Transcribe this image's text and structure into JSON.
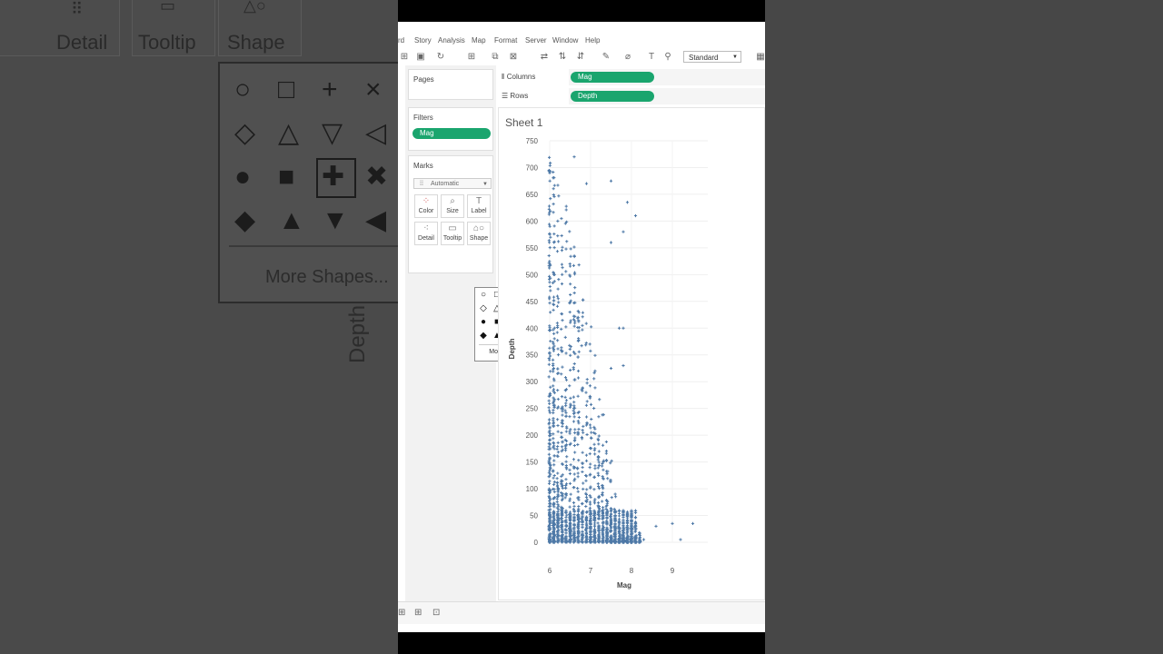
{
  "background": {
    "labels": {
      "detail": "Detail",
      "tooltip": "Tooltip",
      "shape": "Shape"
    },
    "more_shapes": "More Shapes...",
    "depth": "Depth"
  },
  "menu": [
    "rd",
    "Story",
    "Analysis",
    "Map",
    "Format",
    "Server",
    "Window",
    "Help"
  ],
  "toolbar": {
    "fit_select": "Standard"
  },
  "shelves": {
    "pages": "Pages",
    "filters": "Filters",
    "filter_pill": "Mag",
    "marks": "Marks",
    "mark_type": "Automatic",
    "columns_label": "Columns",
    "columns_pill": "Mag",
    "rows_label": "Rows",
    "rows_pill": "Depth"
  },
  "mark_buttons": [
    "Color",
    "Size",
    "Label",
    "Detail",
    "Tooltip",
    "Shape"
  ],
  "shape_popup": {
    "shapes": [
      [
        "○",
        "□",
        "+",
        "×",
        "✱"
      ],
      [
        "◇",
        "△",
        "▽",
        "◁",
        "▷"
      ],
      [
        "●",
        "■",
        "✚",
        "✖",
        "★"
      ],
      [
        "◆",
        "▲",
        "▼",
        "◀",
        "▶"
      ]
    ],
    "selected": "✚",
    "more_shapes": "More Shapes..."
  },
  "sheet": {
    "title": "Sheet 1"
  },
  "chart_data": {
    "type": "scatter",
    "title": "",
    "xlabel": "Mag",
    "ylabel": "Depth",
    "xlim": [
      6,
      10
    ],
    "ylim": [
      0,
      750
    ],
    "x_ticks": [
      6,
      7,
      8,
      9
    ],
    "y_ticks": [
      0,
      50,
      100,
      150,
      200,
      250,
      300,
      350,
      400,
      450,
      500,
      550,
      600,
      650,
      700,
      750
    ],
    "marker": "plus",
    "color": "#4e79a7",
    "points_sample": [
      [
        6.0,
        690
      ],
      [
        6.6,
        720
      ],
      [
        6.9,
        670
      ],
      [
        7.5,
        675
      ],
      [
        7.9,
        635
      ],
      [
        8.1,
        610
      ],
      [
        7.8,
        580
      ],
      [
        7.5,
        560
      ],
      [
        7.7,
        400
      ],
      [
        7.8,
        400
      ],
      [
        7.8,
        330
      ],
      [
        7.5,
        325
      ],
      [
        8.0,
        40
      ],
      [
        8.6,
        30
      ],
      [
        9.0,
        35
      ],
      [
        9.5,
        35
      ],
      [
        9.2,
        5
      ],
      [
        8.3,
        5
      ]
    ]
  },
  "colors": {
    "pill_green": "#1aa56e",
    "mark_blue": "#4e79a7"
  }
}
